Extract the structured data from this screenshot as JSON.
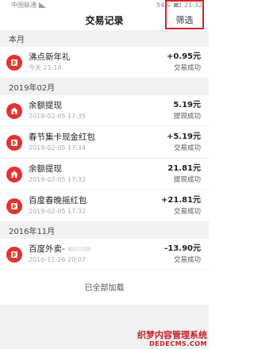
{
  "status_bar": {
    "carrier": "中国联通",
    "battery": "54%",
    "time": "21:32"
  },
  "nav": {
    "title": "交易记录",
    "filter_label": "筛选"
  },
  "sections": [
    {
      "header": "本月"
    },
    {
      "header": "2019年02月"
    },
    {
      "header": "2016年11月"
    }
  ],
  "transactions": [
    {
      "title": "沸点新年礼",
      "date": "今天 21:18",
      "amount": "+0.95元",
      "status": "交易成功",
      "icon": "red-envelope-icon"
    },
    {
      "title": "余额提现",
      "date": "2019-02-05 17:35",
      "amount": "5.19元",
      "status": "提现成功",
      "icon": "house-icon"
    },
    {
      "title": "春节集卡现金红包",
      "date": "2019-02-05 17:34",
      "amount": "+5.19元",
      "status": "交易成功",
      "icon": "red-envelope-icon"
    },
    {
      "title": "余额提现",
      "date": "2019-02-05 17:32",
      "amount": "21.81元",
      "status": "提现成功",
      "icon": "house-icon"
    },
    {
      "title": "百度春晚摇红包",
      "date": "2019-02-05 17:32",
      "amount": "+21.81元",
      "status": "交易成功",
      "icon": "red-envelope-icon"
    },
    {
      "title": "百度外卖-",
      "date": "2016-11-26 20:07",
      "amount": "-13.90元",
      "status": "交易成功",
      "icon": "red-envelope-icon"
    }
  ],
  "footer": {
    "text": "已全部加载"
  },
  "watermark": {
    "line1": "织梦内容管理系统",
    "line2": "DEDECMS.COM"
  }
}
